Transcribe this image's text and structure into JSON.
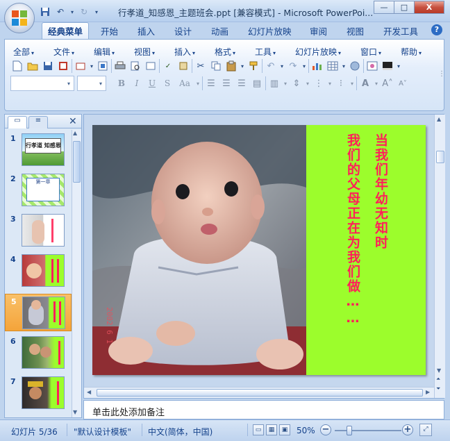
{
  "window": {
    "title": "行孝道_知感恩_主题班会.ppt [兼容模式] - Microsoft PowerPoi...",
    "minimize": "—",
    "maximize": "□",
    "close": "X"
  },
  "ribbon_tabs": [
    "经典菜单",
    "开始",
    "插入",
    "设计",
    "动画",
    "幻灯片放映",
    "审阅",
    "视图",
    "开发工具"
  ],
  "active_tab_index": 0,
  "classic_menu": [
    "全部",
    "文件",
    "编辑",
    "视图",
    "插入",
    "格式",
    "工具",
    "幻灯片放映",
    "窗口",
    "帮助"
  ],
  "format_toolbar": {
    "bold": "B",
    "italic": "I",
    "underline": "U",
    "shadow": "S",
    "change_case": "Aa"
  },
  "slides": {
    "numbers": [
      "1",
      "2",
      "3",
      "4",
      "5",
      "6",
      "7"
    ],
    "selected_index": 4,
    "thumb_titles": {
      "s1": "行孝道 知感恩",
      "s2": "第一章"
    }
  },
  "current_slide": {
    "date_stamp": "2002 6 1",
    "text_col1": "当我们年幼无知时",
    "text_col2": "我们的父母正在为我们做……",
    "panel_color": "#9cfd2c",
    "text_color": "#ff1f5a"
  },
  "notes_placeholder": "单击此处添加备注",
  "status": {
    "slide_counter": "幻灯片 5/36",
    "template": "\"默认设计模板\"",
    "language": "中文(简体，中国)",
    "zoom": "50%"
  }
}
